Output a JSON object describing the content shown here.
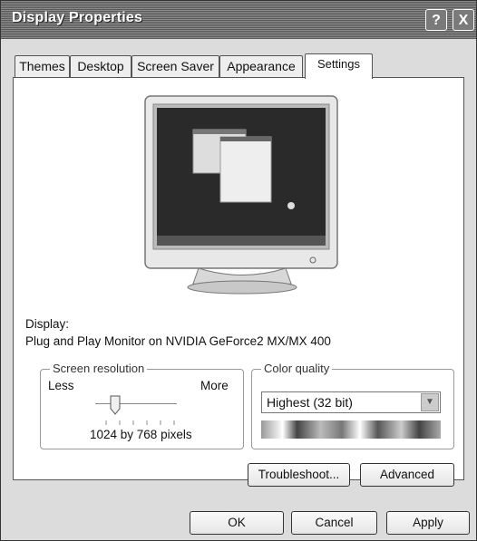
{
  "window": {
    "title": "Display Properties",
    "help_label": "?",
    "close_label": "X"
  },
  "tabs": [
    {
      "label": "Themes"
    },
    {
      "label": "Desktop"
    },
    {
      "label": "Screen Saver"
    },
    {
      "label": "Appearance"
    },
    {
      "label": "Settings"
    }
  ],
  "display": {
    "label": "Display:",
    "monitor_name": "Plug and Play Monitor on NVIDIA GeForce2 MX/MX 400"
  },
  "resolution": {
    "legend": "Screen resolution",
    "less_label": "Less",
    "more_label": "More",
    "value_text": "1024 by 768 pixels"
  },
  "color_quality": {
    "legend": "Color quality",
    "selected": "Highest (32 bit)"
  },
  "buttons": {
    "troubleshoot": "Troubleshoot...",
    "advanced": "Advanced",
    "ok": "OK",
    "cancel": "Cancel",
    "apply": "Apply"
  }
}
